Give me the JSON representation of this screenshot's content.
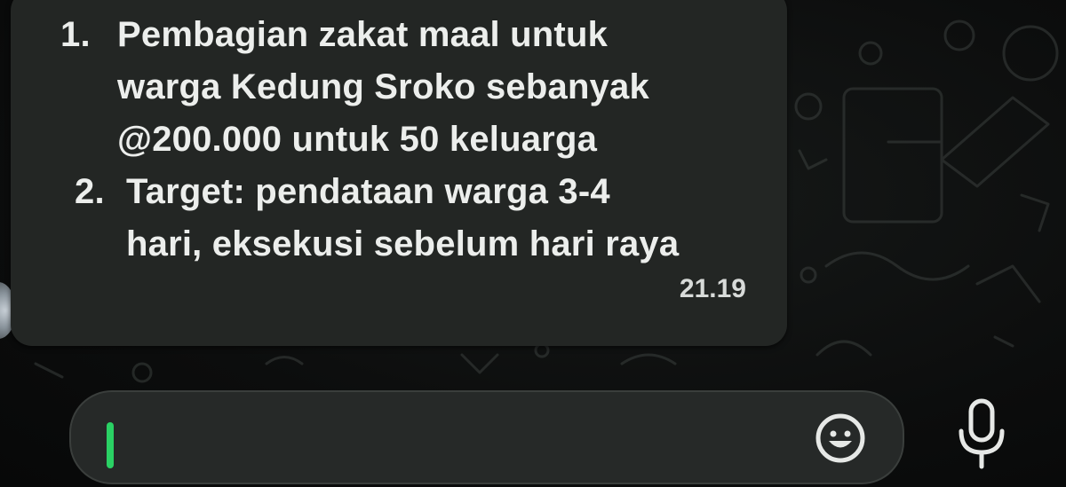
{
  "message": {
    "items": [
      {
        "number": "1.",
        "lines": [
          "Pembagian zakat maal untuk",
          "warga Kedung Sroko sebanyak",
          "@200.000 untuk 50 keluarga"
        ]
      },
      {
        "number": "2.",
        "lines": [
          "Target: pendataan warga 3-4",
          "hari, eksekusi sebelum hari raya"
        ]
      }
    ],
    "time": "21.19"
  },
  "composer": {
    "value": "",
    "emoji_icon": "smiley-icon",
    "mic_icon": "microphone-icon",
    "cursor_color": "#2ad164"
  },
  "colors": {
    "bubble": "#232624",
    "background": "#0b0c0c",
    "text": "#eceeec"
  }
}
